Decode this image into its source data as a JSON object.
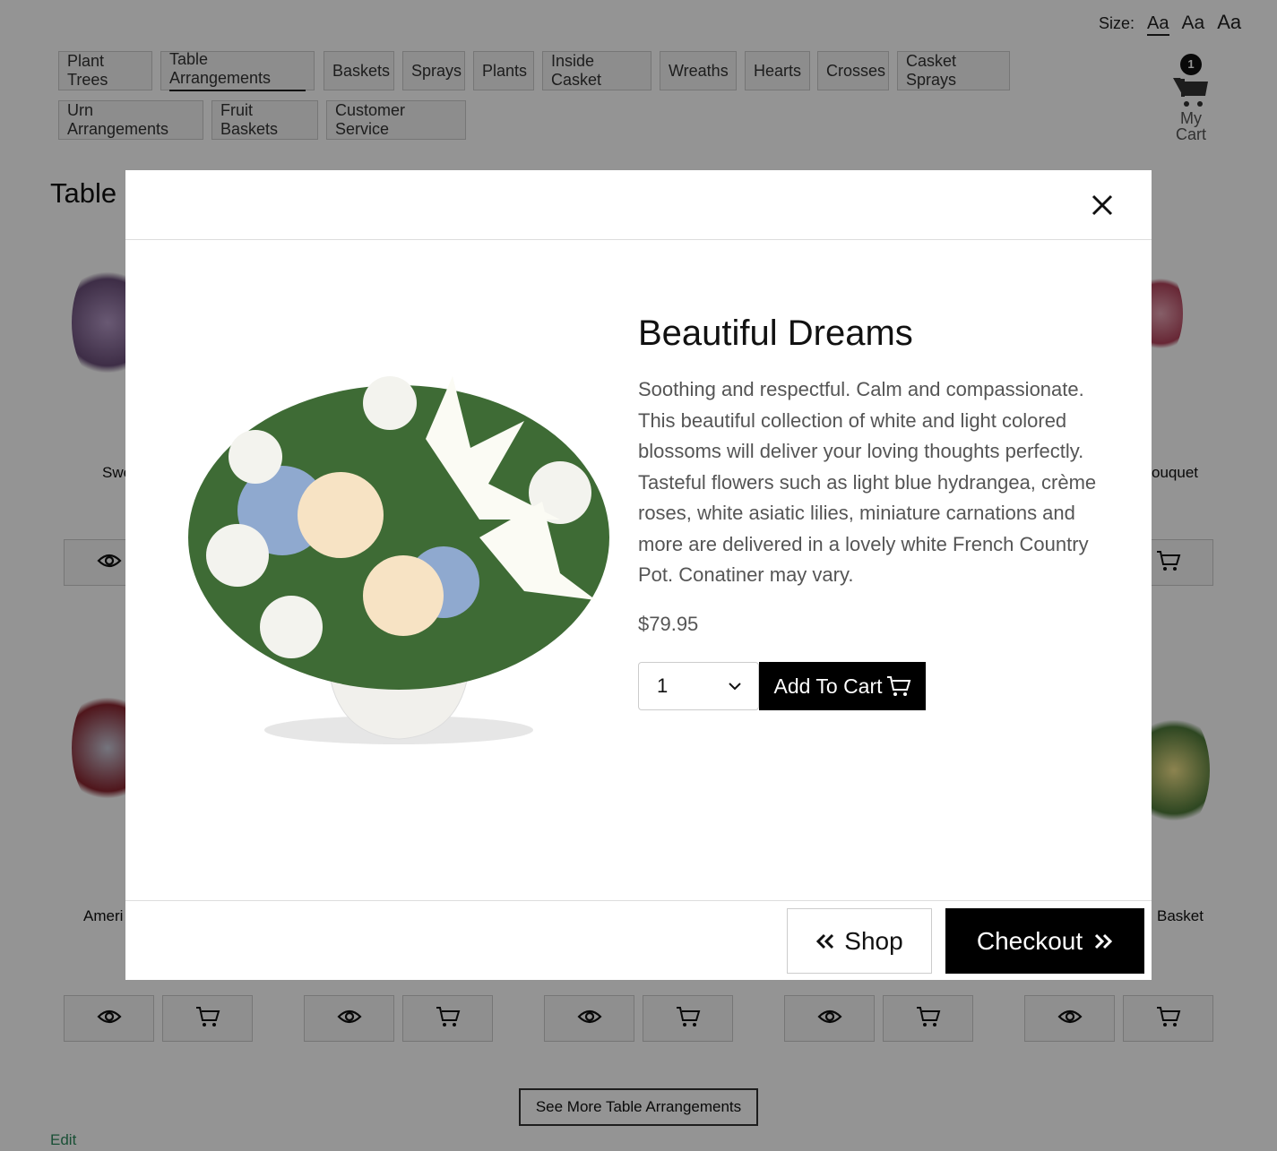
{
  "size_control": {
    "label": "Size:",
    "options": [
      "Aa",
      "Aa",
      "Aa"
    ],
    "selected": 0
  },
  "nav": {
    "tabs": [
      {
        "label": "Plant Trees"
      },
      {
        "label": "Table Arrangements",
        "active": true
      },
      {
        "label": "Baskets"
      },
      {
        "label": "Sprays"
      },
      {
        "label": "Plants"
      },
      {
        "label": "Inside Casket"
      },
      {
        "label": "Wreaths"
      },
      {
        "label": "Hearts"
      },
      {
        "label": "Crosses"
      },
      {
        "label": "Casket Sprays"
      },
      {
        "label": "Urn Arrangements"
      },
      {
        "label": "Fruit Baskets"
      },
      {
        "label": "Customer Service"
      }
    ]
  },
  "cart": {
    "count": "1",
    "label_line1": "My",
    "label_line2": "Cart",
    "icon": "cart-icon"
  },
  "page": {
    "title": "Table",
    "products_visible_text": [
      "Swe",
      "ouquet",
      "Ameri",
      "Basket"
    ],
    "see_more": "See More Table Arrangements",
    "edit": "Edit"
  },
  "modal": {
    "title": "Beautiful Dreams",
    "description": "Soothing and respectful. Calm and compassionate. This beautiful collection of white and light colored blossoms will deliver your loving thoughts perfectly. Tasteful flowers such as light blue hydrangea, crème roses, white asiatic lilies, miniature carnations and more are delivered in a lovely white French Country Pot. Conatiner may vary.",
    "price": "$79.95",
    "quantity": "1",
    "add_to_cart": "Add To Cart",
    "shop": "Shop",
    "checkout": "Checkout"
  },
  "colors": {
    "overlay": "#949494",
    "button_primary": "#000000",
    "edit_link": "#2d8a5e"
  }
}
